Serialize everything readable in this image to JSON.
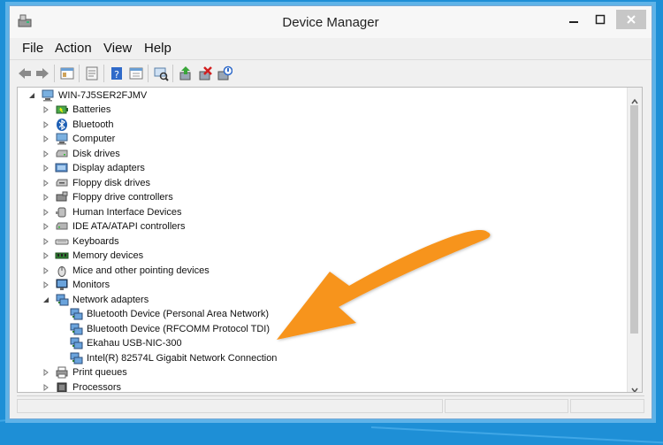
{
  "window": {
    "title": "Device Manager"
  },
  "menu": [
    "File",
    "Action",
    "View",
    "Help"
  ],
  "toolbar_icons": [
    "back-icon",
    "forward-icon",
    "show-hide-tree-icon",
    "properties-icon",
    "help-icon",
    "view-icon",
    "scan-hardware-icon",
    "update-driver-icon",
    "uninstall-icon",
    "disable-icon"
  ],
  "tree": {
    "root": "WIN-7J5SER2FJMV",
    "categories": [
      {
        "label": "Batteries",
        "icon": "battery-icon"
      },
      {
        "label": "Bluetooth",
        "icon": "bluetooth-icon"
      },
      {
        "label": "Computer",
        "icon": "computer-icon"
      },
      {
        "label": "Disk drives",
        "icon": "disk-drive-icon"
      },
      {
        "label": "Display adapters",
        "icon": "display-adapter-icon"
      },
      {
        "label": "Floppy disk drives",
        "icon": "floppy-disk-icon"
      },
      {
        "label": "Floppy drive controllers",
        "icon": "floppy-controller-icon"
      },
      {
        "label": "Human Interface Devices",
        "icon": "hid-icon"
      },
      {
        "label": "IDE ATA/ATAPI controllers",
        "icon": "ide-controller-icon"
      },
      {
        "label": "Keyboards",
        "icon": "keyboard-icon"
      },
      {
        "label": "Memory devices",
        "icon": "memory-icon"
      },
      {
        "label": "Mice and other pointing devices",
        "icon": "mouse-icon"
      },
      {
        "label": "Monitors",
        "icon": "monitor-icon"
      },
      {
        "label": "Network adapters",
        "icon": "network-adapter-icon",
        "expanded": true,
        "children": [
          "Bluetooth Device (Personal Area Network)",
          "Bluetooth Device (RFCOMM Protocol TDI)",
          "Ekahau USB-NIC-300",
          "Intel(R) 82574L Gigabit Network Connection"
        ]
      },
      {
        "label": "Print queues",
        "icon": "printer-icon"
      },
      {
        "label": "Processors",
        "icon": "processor-icon"
      }
    ]
  },
  "annotation": {
    "arrow_color": "#f7941d"
  }
}
